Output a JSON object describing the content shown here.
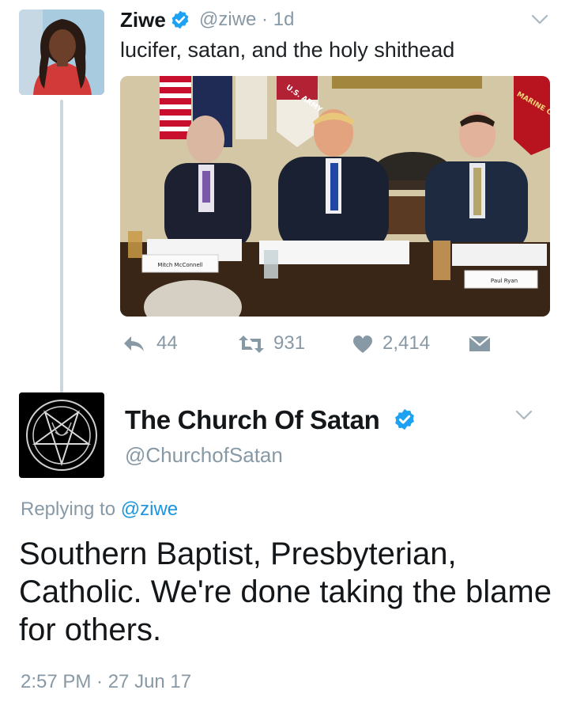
{
  "tweet": {
    "author_name": "Ziwe",
    "handle": "@ziwe",
    "separator": "·",
    "time_ago": "1d",
    "text": "lucifer, satan, and the holy shithead",
    "photo": {
      "placards": [
        "Mitch McConnell",
        "Paul Ryan"
      ],
      "flag_text": [
        "U.S. ARMY",
        "MARINE CORPS"
      ]
    },
    "actions": {
      "replies": "44",
      "retweets": "931",
      "likes": "2,414"
    }
  },
  "reply": {
    "author_name": "The Church Of Satan",
    "handle": "@ChurchofSatan",
    "replying_prefix": "Replying to",
    "replying_handle": "@ziwe",
    "text": "Southern Baptist, Presbyterian, Catholic. We're done taking the blame for others.",
    "timestamp": "2:57 PM · 27 Jun 17"
  },
  "colors": {
    "verified_blue": "#1da1f2",
    "link_blue": "#1b95e0",
    "muted_gray": "#8899a6",
    "thread_line": "#ccd6dd"
  },
  "icons": [
    "verified-badge-icon",
    "chevron-down-icon",
    "reply-icon",
    "retweet-icon",
    "like-heart-icon",
    "direct-message-icon"
  ]
}
